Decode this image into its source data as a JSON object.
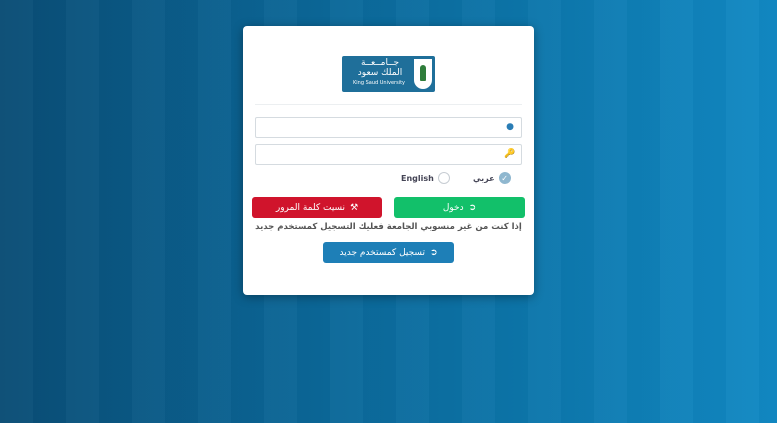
{
  "logo": {
    "arabic_name": "جــامــعــة الملك سعود",
    "english_name": "King Saud University",
    "icon": "palm-swords-emblem"
  },
  "form": {
    "username": {
      "value": "",
      "placeholder": "",
      "icon": "user-icon"
    },
    "password": {
      "value": "",
      "placeholder": "",
      "icon": "key-icon"
    }
  },
  "language": {
    "options": [
      {
        "label": "عربي",
        "selected": true
      },
      {
        "label": "English",
        "selected": false
      }
    ]
  },
  "buttons": {
    "login_label": "دخول",
    "forgot_label": "نسيت كلمة المرور",
    "register_label": "تسجيل كمستخدم جديد"
  },
  "note": "إذا كنت من غير منسوبي الجامعة فعليك التسجيل كمستخدم جديد",
  "colors": {
    "login": "#12c06a",
    "forgot": "#d0142c",
    "register": "#1e7fb7",
    "logo_bg": "#1f6f9a"
  }
}
